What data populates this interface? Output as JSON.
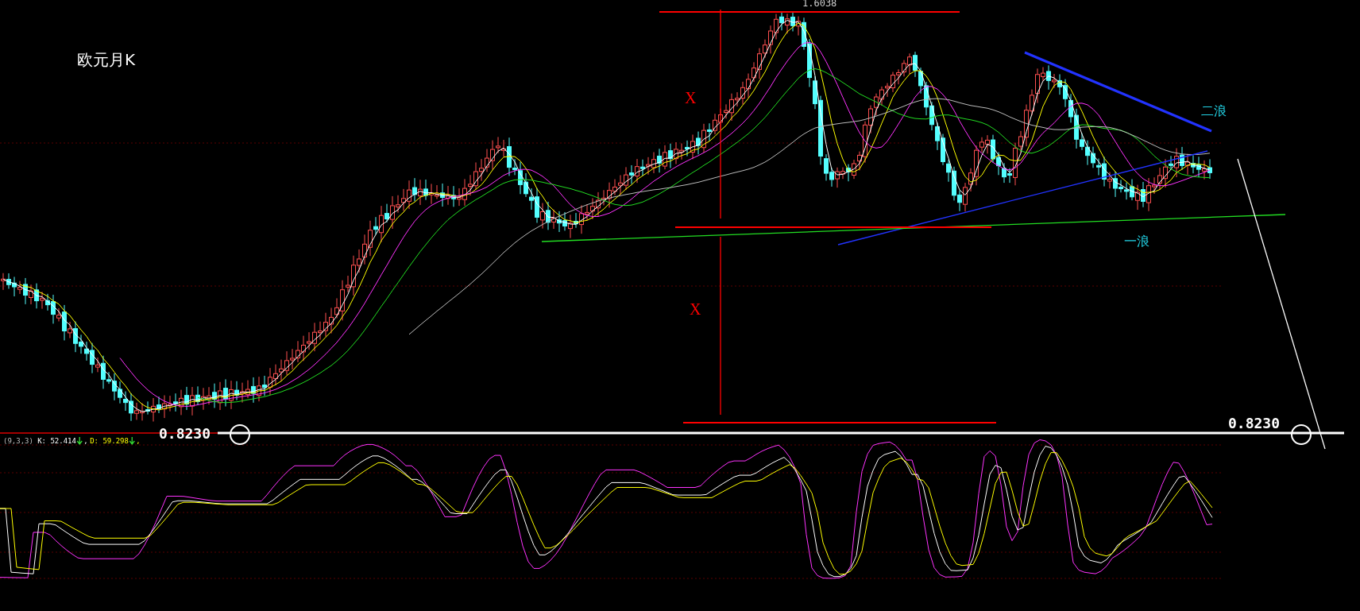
{
  "chart": {
    "title": "欧元月K",
    "top_price": "1.6038",
    "measure_marks": [
      "X",
      "X"
    ],
    "wave_labels": [
      {
        "label": "二浪",
        "kind": "upper"
      },
      {
        "label": "一浪",
        "kind": "lower"
      }
    ],
    "price_labels": [
      "0.8230",
      "0.8230"
    ]
  },
  "indicator": {
    "params": "(9,3,3)",
    "values": [
      {
        "label": "K: 52.414",
        "kind": "k"
      },
      {
        "label": "D: 59.298",
        "kind": "d"
      }
    ],
    "separator": ","
  }
}
